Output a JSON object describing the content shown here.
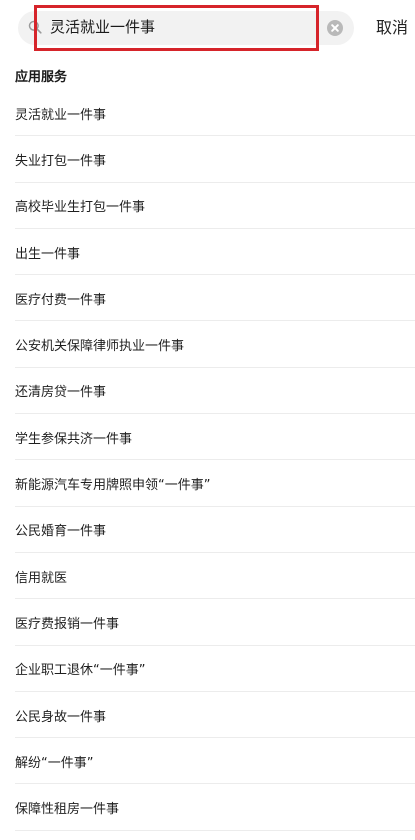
{
  "search": {
    "value": "灵活就业一件事",
    "cancel_label": "取消"
  },
  "section": {
    "title": "应用服务"
  },
  "results": [
    "灵活就业一件事",
    "失业打包一件事",
    "高校毕业生打包一件事",
    "出生一件事",
    "医疗付费一件事",
    "公安机关保障律师执业一件事",
    "还清房贷一件事",
    "学生参保共济一件事",
    "新能源汽车专用牌照申领“一件事”",
    "公民婚育一件事",
    "信用就医",
    "医疗费报销一件事",
    "企业职工退休“一件事”",
    "公民身故一件事",
    "解纷“一件事”",
    "保障性租房一件事"
  ],
  "colors": {
    "highlight_frame": "#d6242a",
    "search_background": "#f2f2f2"
  },
  "icons": {
    "search": "search-icon",
    "clear": "clear-icon"
  }
}
